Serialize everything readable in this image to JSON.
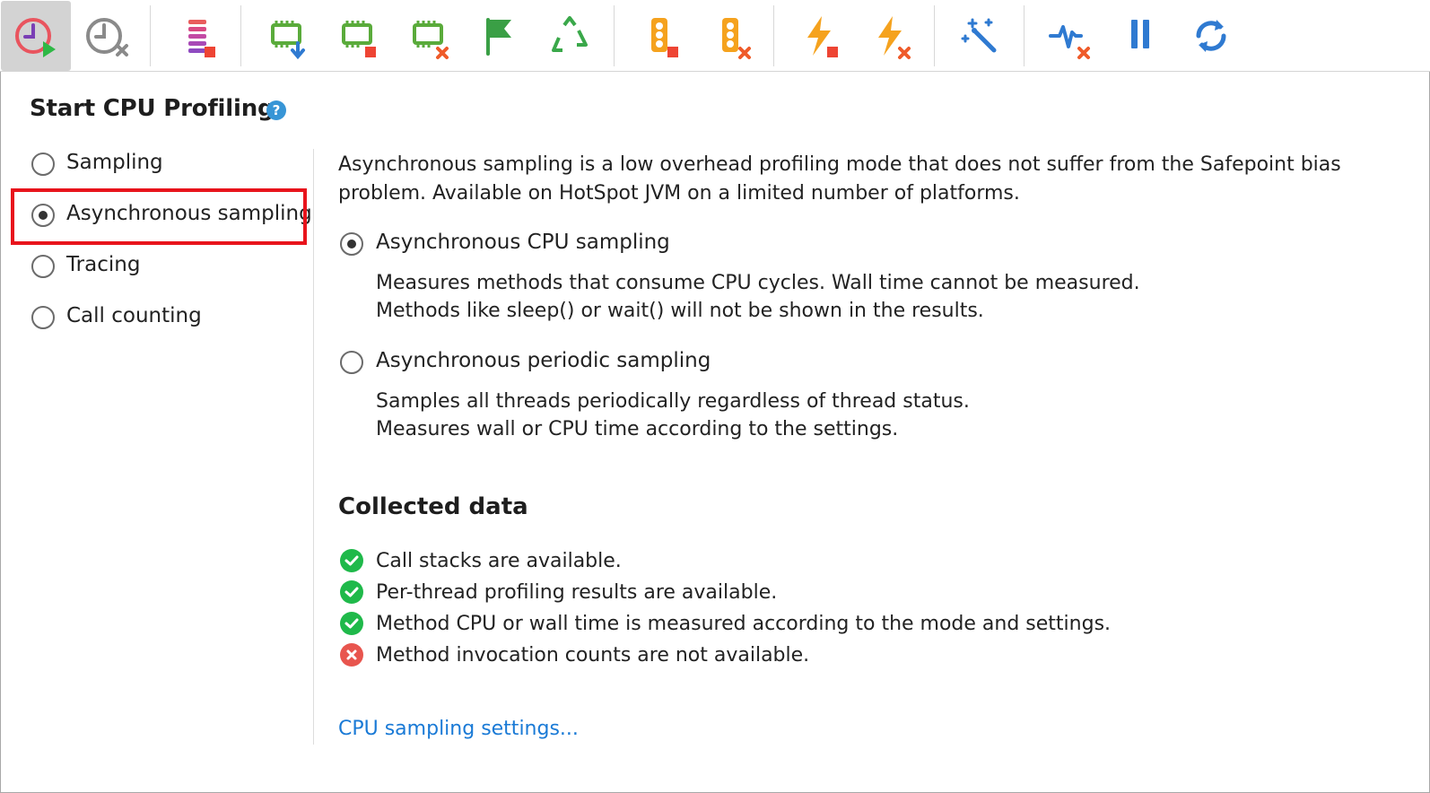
{
  "toolbar": {
    "buttons": [
      {
        "icon": "cpu-start-icon",
        "active": true
      },
      {
        "icon": "cpu-stop-icon",
        "active": false
      },
      {
        "icon": "allocation-stop-icon",
        "active": false
      },
      {
        "icon": "memory-capture-icon",
        "active": false
      },
      {
        "icon": "memory-stop-icon",
        "active": false
      },
      {
        "icon": "memory-clear-icon",
        "active": false
      },
      {
        "icon": "flag-icon",
        "active": false
      },
      {
        "icon": "recycle-gc-icon",
        "active": false
      },
      {
        "icon": "monitor-stop-icon",
        "active": false
      },
      {
        "icon": "monitor-clear-icon",
        "active": false
      },
      {
        "icon": "events-stop-icon",
        "active": false
      },
      {
        "icon": "events-clear-icon",
        "active": false
      },
      {
        "icon": "magic-wand-icon",
        "active": false
      },
      {
        "icon": "telemetry-clear-icon",
        "active": false
      },
      {
        "icon": "pause-icon",
        "active": false
      },
      {
        "icon": "refresh-icon",
        "active": false
      }
    ]
  },
  "panel": {
    "title": "Start CPU Profiling",
    "help_glyph": "?",
    "modes": [
      {
        "label": "Sampling",
        "checked": false
      },
      {
        "label": "Asynchronous sampling",
        "checked": true
      },
      {
        "label": "Tracing",
        "checked": false
      },
      {
        "label": "Call counting",
        "checked": false
      }
    ],
    "description": {
      "line1": "Asynchronous sampling is a low overhead profiling mode that does not suffer from the Safepoint bias",
      "line2": "problem. Available on HotSpot JVM on a limited number of platforms."
    },
    "submodes": [
      {
        "label": "Asynchronous CPU sampling",
        "checked": true,
        "line1": "Measures methods that consume CPU cycles. Wall time cannot be measured.",
        "line2": "Methods like sleep() or wait() will not be shown in the results."
      },
      {
        "label": "Asynchronous periodic sampling",
        "checked": false,
        "line1": "Samples all threads periodically regardless of thread status.",
        "line2": "Measures wall or CPU time according to the settings."
      }
    ],
    "collected_heading": "Collected data",
    "collected": [
      {
        "text": "Call stacks are available.",
        "ok": true
      },
      {
        "text": "Per-thread profiling results are available.",
        "ok": true
      },
      {
        "text": "Method CPU or wall time is measured according to the mode and settings.",
        "ok": true
      },
      {
        "text": "Method invocation counts are not available.",
        "ok": false
      }
    ],
    "settings_link": "CPU sampling settings..."
  },
  "colors": {
    "highlight": "#e8141c",
    "link": "#1a7ad6",
    "ok": "#1fb94a",
    "error": "#e8554e"
  }
}
